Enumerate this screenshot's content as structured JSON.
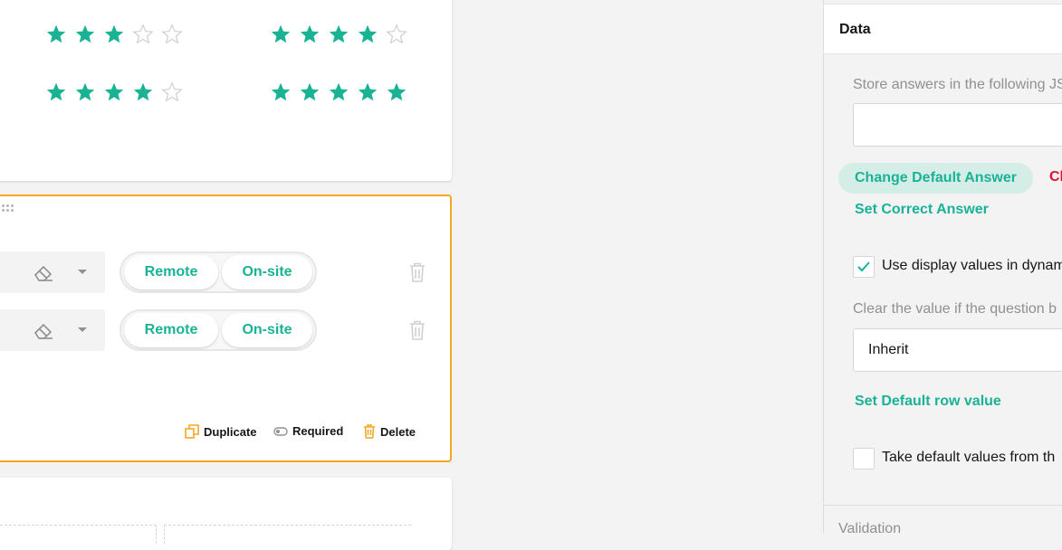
{
  "rating_card": {
    "rows": [
      {
        "left_filled": 3,
        "left_total": 5,
        "right_filled": 4,
        "right_total": 5
      },
      {
        "left_filled": 4,
        "left_total": 5,
        "right_filled": 5,
        "right_total": 5
      }
    ],
    "star_color": "#19b394"
  },
  "matrix_card": {
    "rows": [
      {
        "option_a": "Remote",
        "option_b": "On-site"
      },
      {
        "option_a": "Remote",
        "option_b": "On-site"
      }
    ],
    "actions": {
      "duplicate": "Duplicate",
      "required": "Required",
      "delete": "Delete"
    },
    "selected_border_color": "#f5a623"
  },
  "panel": {
    "header": "Data",
    "store_answers_label": "Store answers in the following JS",
    "store_answers_value": "",
    "change_default_answer": "Change Default Answer",
    "clear_partial": "Cl",
    "set_correct_answer": "Set Correct Answer",
    "use_display_values": {
      "label": "Use display values in dynam",
      "checked": true
    },
    "clear_value_label": "Clear the value if the question b",
    "clear_value_select": "Inherit",
    "set_default_row_value": "Set Default row value",
    "take_default_values": {
      "label": "Take default values from th",
      "checked": false
    },
    "validation": "Validation"
  },
  "colors": {
    "accent": "#19b394",
    "danger": "#e50a3e",
    "selection": "#f5a623"
  }
}
